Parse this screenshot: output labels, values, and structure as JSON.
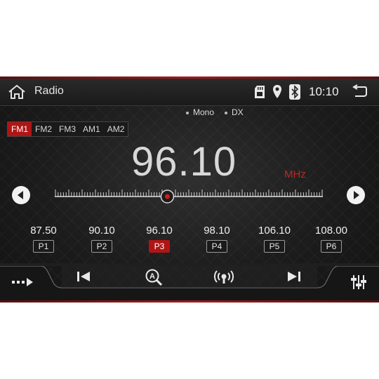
{
  "status": {
    "title": "Radio",
    "time": "10:10",
    "icons": [
      "home-icon",
      "sd-card-icon",
      "location-icon",
      "bluetooth-icon",
      "back-icon"
    ]
  },
  "modes": {
    "mono": "Mono",
    "dx": "DX"
  },
  "bands": [
    "FM1",
    "FM2",
    "FM3",
    "AM1",
    "AM2"
  ],
  "active_band": "FM1",
  "frequency": {
    "value": "96.10",
    "unit": "MHz"
  },
  "dial": {
    "min": 87.5,
    "max": 108.0,
    "current": 96.1
  },
  "presets": [
    {
      "freq": "87.50",
      "label": "P1"
    },
    {
      "freq": "90.10",
      "label": "P2"
    },
    {
      "freq": "96.10",
      "label": "P3"
    },
    {
      "freq": "98.10",
      "label": "P4"
    },
    {
      "freq": "106.10",
      "label": "P5"
    },
    {
      "freq": "108.00",
      "label": "P6"
    }
  ],
  "active_preset": "P3",
  "colors": {
    "accent": "#b01515",
    "background": "#1c1c1c",
    "text": "#d8d8d8"
  },
  "controls": [
    "source-icon",
    "previous-icon",
    "auto-search-icon",
    "broadcast-icon",
    "next-icon",
    "equalizer-icon"
  ]
}
